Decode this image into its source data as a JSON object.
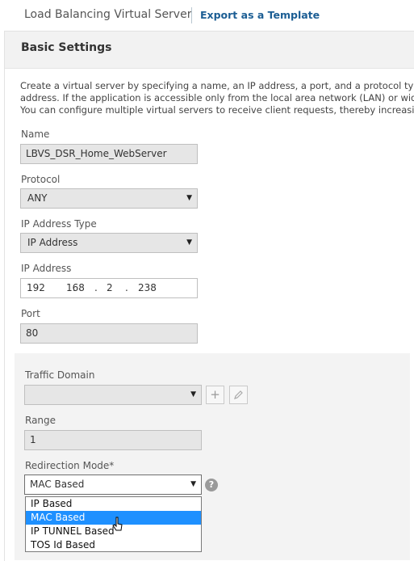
{
  "header": {
    "title": "Load Balancing Virtual Server",
    "export_link": "Export as a Template"
  },
  "section": {
    "title": "Basic Settings",
    "description": [
      "Create a virtual server by specifying a name, an IP address, a port, and a protocol type. If ar",
      "address. If the application is accessible only from the local area network (LAN) or wide area",
      "You can configure multiple virtual servers to receive client requests, thereby increasing the"
    ]
  },
  "form": {
    "name": {
      "label": "Name",
      "value": "LBVS_DSR_Home_WebServer"
    },
    "protocol": {
      "label": "Protocol",
      "value": "ANY"
    },
    "ip_address_type": {
      "label": "IP Address Type",
      "value": "IP Address"
    },
    "ip_address": {
      "label": "IP Address",
      "octets": [
        "192",
        "168",
        "2",
        "238"
      ],
      "separator": "."
    },
    "port": {
      "label": "Port",
      "value": "80"
    },
    "traffic_domain": {
      "label": "Traffic Domain",
      "value": "",
      "add_icon": "plus-icon",
      "edit_icon": "pencil-icon"
    },
    "range": {
      "label": "Range",
      "value": "1"
    },
    "redirection_mode": {
      "label": "Redirection Mode*",
      "value": "MAC Based",
      "help": "?",
      "options": [
        "IP Based",
        "MAC Based",
        "IP TUNNEL Based",
        "TOS Id Based"
      ],
      "highlighted": "MAC Based"
    }
  },
  "colors": {
    "accent": "#1c5e94",
    "highlight": "#1e90ff",
    "readonly_bg": "#e6e6e6"
  }
}
